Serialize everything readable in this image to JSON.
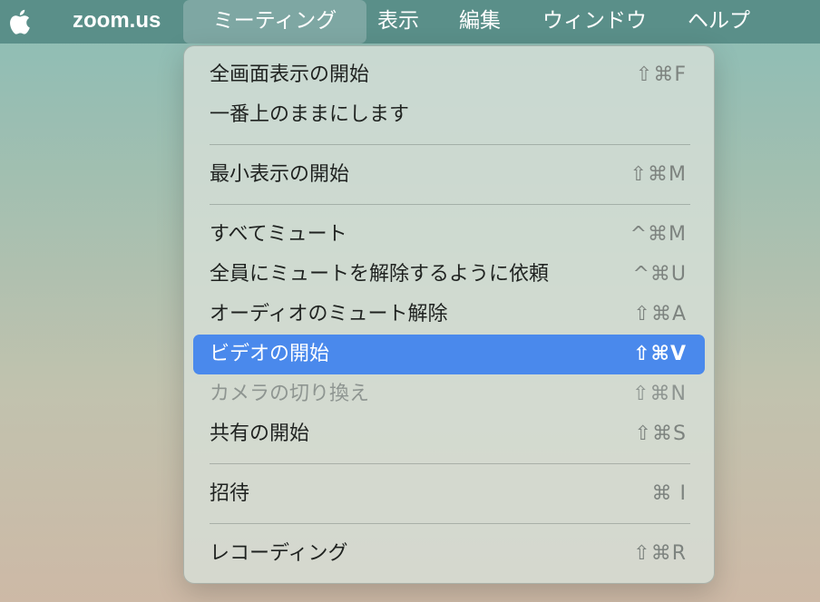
{
  "menubar": {
    "app_name": "zoom.us",
    "items": [
      {
        "label": "ミーティング"
      },
      {
        "label": "表示"
      },
      {
        "label": "編集"
      },
      {
        "label": "ウィンドウ"
      },
      {
        "label": "ヘルプ"
      }
    ],
    "active_item": "ミーティング"
  },
  "menu": {
    "items": [
      {
        "label": "全画面表示の開始",
        "shortcut": "⇧⌘F"
      },
      {
        "label": "一番上のままにします",
        "shortcut": ""
      },
      {
        "label": "最小表示の開始",
        "shortcut": "⇧⌘M"
      },
      {
        "label": "すべてミュート",
        "shortcut": "^⌘M"
      },
      {
        "label": "全員にミュートを解除するように依頼",
        "shortcut": "^⌘U"
      },
      {
        "label": "オーディオのミュート解除",
        "shortcut": "⇧⌘A"
      },
      {
        "label": "ビデオの開始",
        "shortcut": "⇧⌘V",
        "highlighted": true
      },
      {
        "label": "カメラの切り換え",
        "shortcut": "⇧⌘N",
        "disabled": true
      },
      {
        "label": "共有の開始",
        "shortcut": "⇧⌘S"
      },
      {
        "label": "招待",
        "shortcut": "⌘ I"
      },
      {
        "label": "レコーディング",
        "shortcut": "⇧⌘R"
      }
    ]
  },
  "colors": {
    "highlight": "#4a89ec",
    "menubar": "#568b86"
  },
  "icons": {
    "apple": "apple-logo-icon"
  }
}
